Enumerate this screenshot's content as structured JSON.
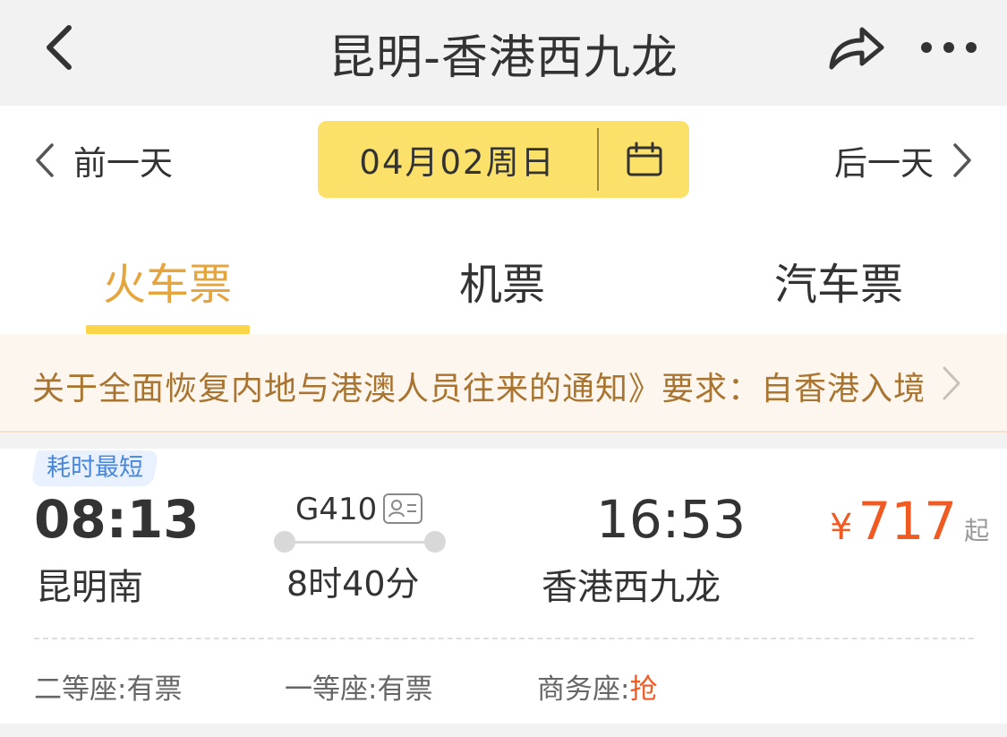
{
  "header": {
    "title": "昆明-香港西九龙",
    "back_icon": "chevron-left-icon",
    "share_icon": "share-icon",
    "more_icon": "more-dots-icon"
  },
  "date_bar": {
    "prev_label": "前一天",
    "next_label": "后一天",
    "date": "04月02周日",
    "pill_color": "#fbe16a"
  },
  "tabs": [
    {
      "label": "火车票",
      "active": true
    },
    {
      "label": "机票",
      "active": false
    },
    {
      "label": "汽车票",
      "active": false
    }
  ],
  "accent_color": "#e6a43c",
  "notice": {
    "text": "关于全面恢复内地与港澳人员往来的通知》要求：自香港入境"
  },
  "train": {
    "badge": "耗时最短",
    "departure_time": "08:13",
    "departure_station": "昆明南",
    "train_number": "G410",
    "duration": "8时40分",
    "arrival_time": "16:53",
    "arrival_station": "香港西九龙",
    "price_currency": "¥",
    "price_value": "717",
    "price_suffix": "起",
    "price_color": "#f05a23",
    "seats": [
      {
        "class": "二等座:",
        "status": "有票"
      },
      {
        "class": "一等座:",
        "status": "有票"
      },
      {
        "class": "商务座:",
        "status": "抢"
      }
    ]
  }
}
